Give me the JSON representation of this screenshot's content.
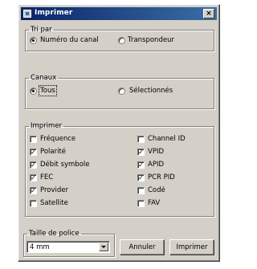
{
  "window": {
    "title": "Imprimer",
    "close_glyph": "×",
    "icon": "printer-app-icon"
  },
  "tri_par": {
    "legend": "Tri par",
    "options": [
      {
        "label": "Numéro du canal",
        "selected": true
      },
      {
        "label": "Transpondeur",
        "selected": false
      }
    ]
  },
  "canaux": {
    "legend": "Canaux",
    "options": [
      {
        "label": "Tous",
        "selected": true
      },
      {
        "label": "Sélectionnés",
        "selected": false
      }
    ]
  },
  "imprimer": {
    "legend": "Imprimer",
    "left": [
      {
        "label": "Fréquence",
        "checked": false
      },
      {
        "label": "Polarité",
        "checked": true
      },
      {
        "label": "Débit symbole",
        "checked": true
      },
      {
        "label": "FEC",
        "checked": true
      },
      {
        "label": "Provider",
        "checked": true
      },
      {
        "label": "Satellite",
        "checked": false
      }
    ],
    "right": [
      {
        "label": "Channel ID",
        "checked": false
      },
      {
        "label": "VPID",
        "checked": true
      },
      {
        "label": "APID",
        "checked": true
      },
      {
        "label": "PCR PID",
        "checked": true
      },
      {
        "label": "Codé",
        "checked": false
      },
      {
        "label": "FAV",
        "checked": false
      }
    ]
  },
  "taille_police": {
    "legend": "Taille de police",
    "value": "4 mm"
  },
  "buttons": {
    "cancel": "Annuler",
    "print": "Imprimer"
  },
  "check_glyph": "✓"
}
